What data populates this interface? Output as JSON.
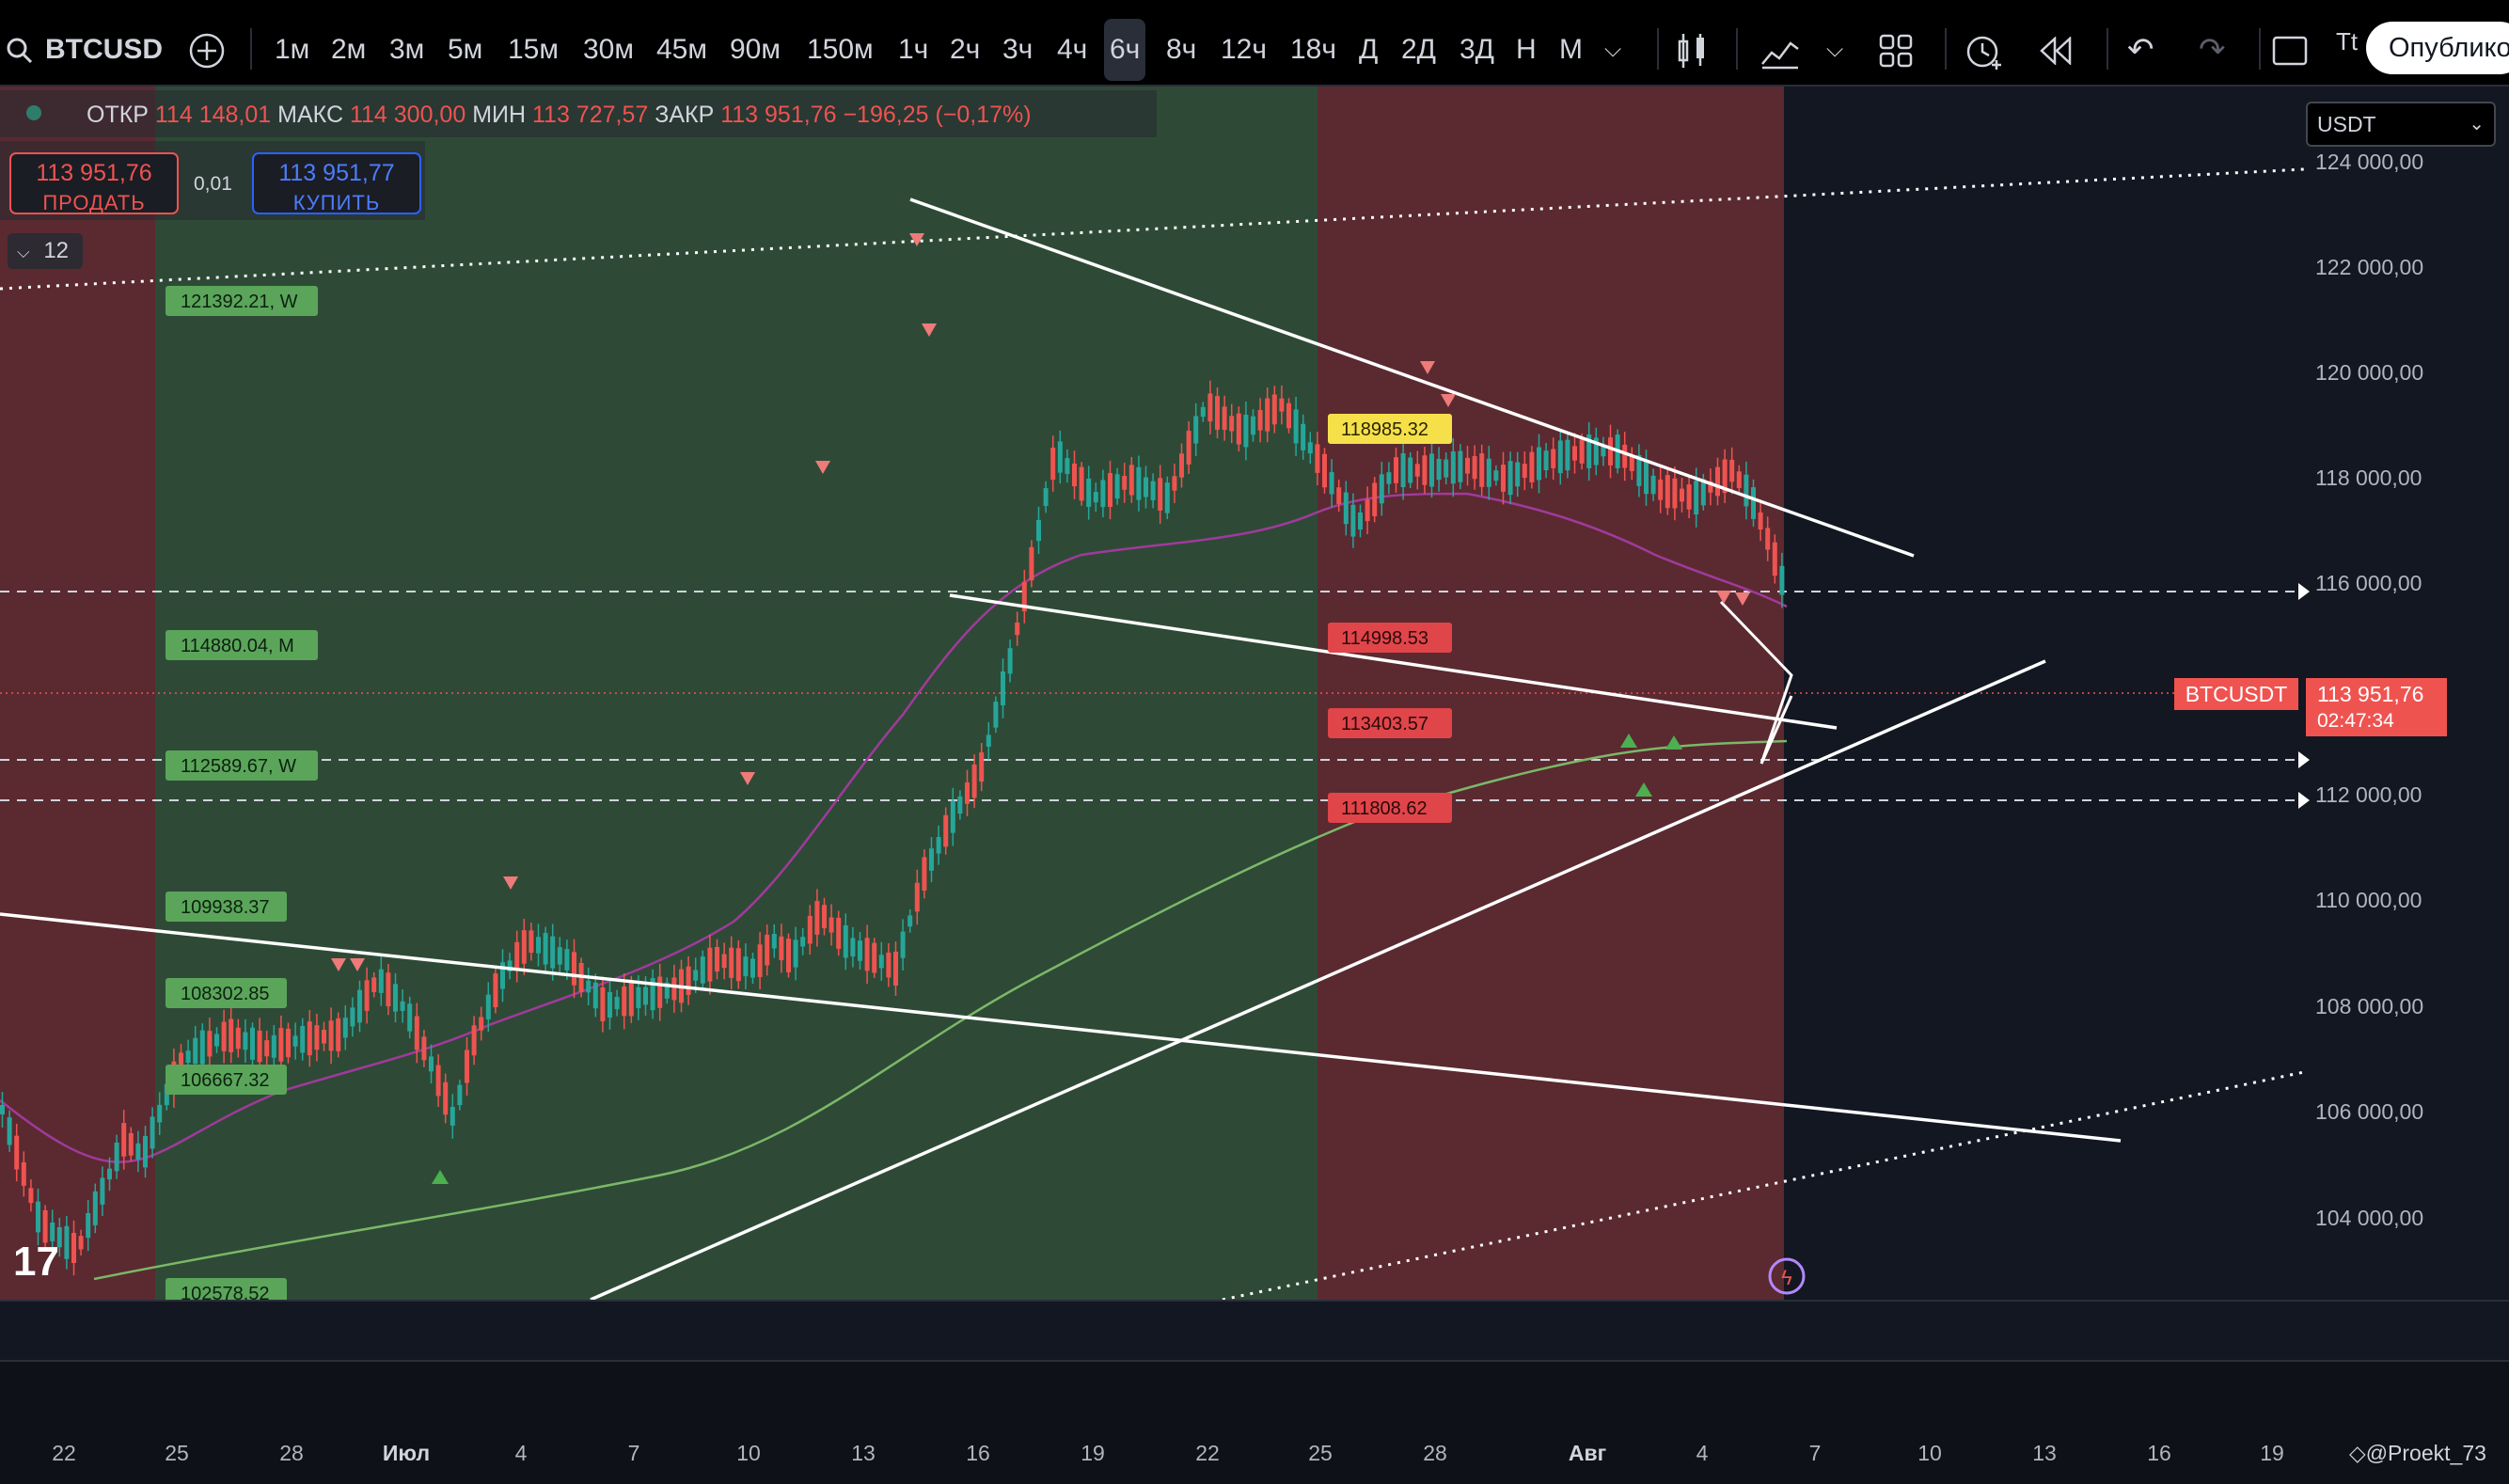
{
  "toolbar": {
    "symbol": "BTCUSD",
    "timeframes": [
      "1м",
      "2м",
      "3м",
      "5м",
      "15м",
      "30м",
      "45м",
      "90м",
      "150м",
      "1ч",
      "2ч",
      "3ч",
      "4ч",
      "6ч",
      "8ч",
      "12ч",
      "18ч",
      "Д",
      "2Д",
      "3Д",
      "Н",
      "М"
    ],
    "active_timeframe": "6ч",
    "overflow_label": "Tt",
    "publish_label": "Опублико"
  },
  "legend": {
    "open_label": "ОТКР",
    "open": "114 148,01",
    "high_label": "МАКС",
    "high": "114 300,00",
    "low_label": "МИН",
    "low": "113 727,57",
    "close_label": "ЗАКР",
    "close": "113 951,76",
    "change": "−196,25 (−0,17%)"
  },
  "trade": {
    "sell_price": "113 951,76",
    "sell_label": "ПРОДАТЬ",
    "spread": "0,01",
    "buy_price": "113 951,77",
    "buy_label": "КУПИТЬ"
  },
  "indicators_count": "12",
  "currency": "USDT",
  "price_axis": [
    "124 000,00",
    "122 000,00",
    "120 000,00",
    "118 000,00",
    "116 000,00",
    "114 000,00",
    "112 000,00",
    "110 000,00",
    "108 000,00",
    "106 000,00",
    "104 000,00"
  ],
  "last_price": {
    "symbol": "BTCUSDT",
    "price": "113 951,76",
    "countdown": "02:47:34"
  },
  "levels_green": [
    "121392.21, W",
    "114880.04, M",
    "112589.67, W",
    "109938.37",
    "108302.85",
    "106667.32",
    "102578.52"
  ],
  "levels_red": [
    "114998.53",
    "113403.57",
    "111808.62"
  ],
  "level_yellow": "118985.32",
  "time_axis": [
    "22",
    "25",
    "28",
    "Июл",
    "4",
    "7",
    "10",
    "13",
    "16",
    "19",
    "22",
    "25",
    "28",
    "Авг",
    "4",
    "7",
    "10",
    "13",
    "16",
    "19"
  ],
  "watermark": "@Proekt_73",
  "colors": {
    "up": "#26a69a",
    "down": "#ef5350",
    "bg": "#131722",
    "green_zone": "#2e4a36",
    "red_zone": "#5a2a30"
  }
}
